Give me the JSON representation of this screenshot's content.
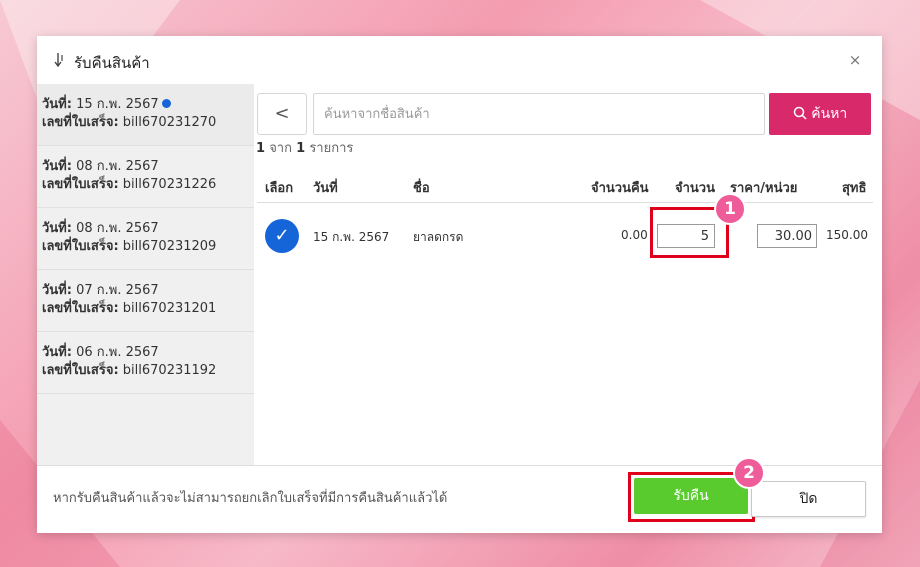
{
  "dialog": {
    "title": "รับคืนสินค้า",
    "close_symbol": "×",
    "footer_note": "หากรับคืนสินค้าแล้วจะไม่สามารถยกเลิกใบเสร็จที่มีการคืนสินค้าแล้วได้",
    "return_label": "รับคืน",
    "close_label": "ปิด"
  },
  "bills": [
    {
      "date_label": "วันที่:",
      "date": "15 ก.พ. 2567",
      "bill_label": "เลขที่ใบเสร็จ:",
      "bill_no": "bill670231270",
      "selected": true
    },
    {
      "date_label": "วันที่:",
      "date": "08 ก.พ. 2567",
      "bill_label": "เลขที่ใบเสร็จ:",
      "bill_no": "bill670231226",
      "selected": false
    },
    {
      "date_label": "วันที่:",
      "date": "08 ก.พ. 2567",
      "bill_label": "เลขที่ใบเสร็จ:",
      "bill_no": "bill670231209",
      "selected": false
    },
    {
      "date_label": "วันที่:",
      "date": "07 ก.พ. 2567",
      "bill_label": "เลขที่ใบเสร็จ:",
      "bill_no": "bill670231201",
      "selected": false
    },
    {
      "date_label": "วันที่:",
      "date": "06 ก.พ. 2567",
      "bill_label": "เลขที่ใบเสร็จ:",
      "bill_no": "bill670231192",
      "selected": false
    }
  ],
  "search": {
    "back_symbol": "<",
    "placeholder": "ค้นหาจากชื่อสินค้า",
    "value": "",
    "button_label": "ค้นหา"
  },
  "results": {
    "shown": "1",
    "of_word": "จาก",
    "total": "1",
    "suffix": "รายการ"
  },
  "table": {
    "headers": {
      "select": "เลือก",
      "date": "วันที่",
      "name": "ชื่อ",
      "returned_qty": "จำนวนคืน",
      "qty": "จำนวน",
      "unit_price": "ราคา/หน่วย",
      "net": "สุทธิ"
    },
    "rows": [
      {
        "check_symbol": "✓",
        "date": "15 ก.พ. 2567",
        "name": "ยาลดกรด",
        "returned_qty": "0.00",
        "qty": "5",
        "unit_price": "30.00",
        "net": "150.00"
      }
    ]
  },
  "badges": {
    "step1": "1",
    "step2": "2"
  },
  "colors": {
    "accent_pink": "#d8296a",
    "return_green": "#5acb2f",
    "check_blue": "#1565d8",
    "highlight_red": "#e0001b",
    "badge_pink": "#ef5c9a"
  },
  "icons": {
    "title": "return-arrow-icon",
    "search": "search-icon",
    "close": "close-icon",
    "back": "chevron-left-icon"
  }
}
